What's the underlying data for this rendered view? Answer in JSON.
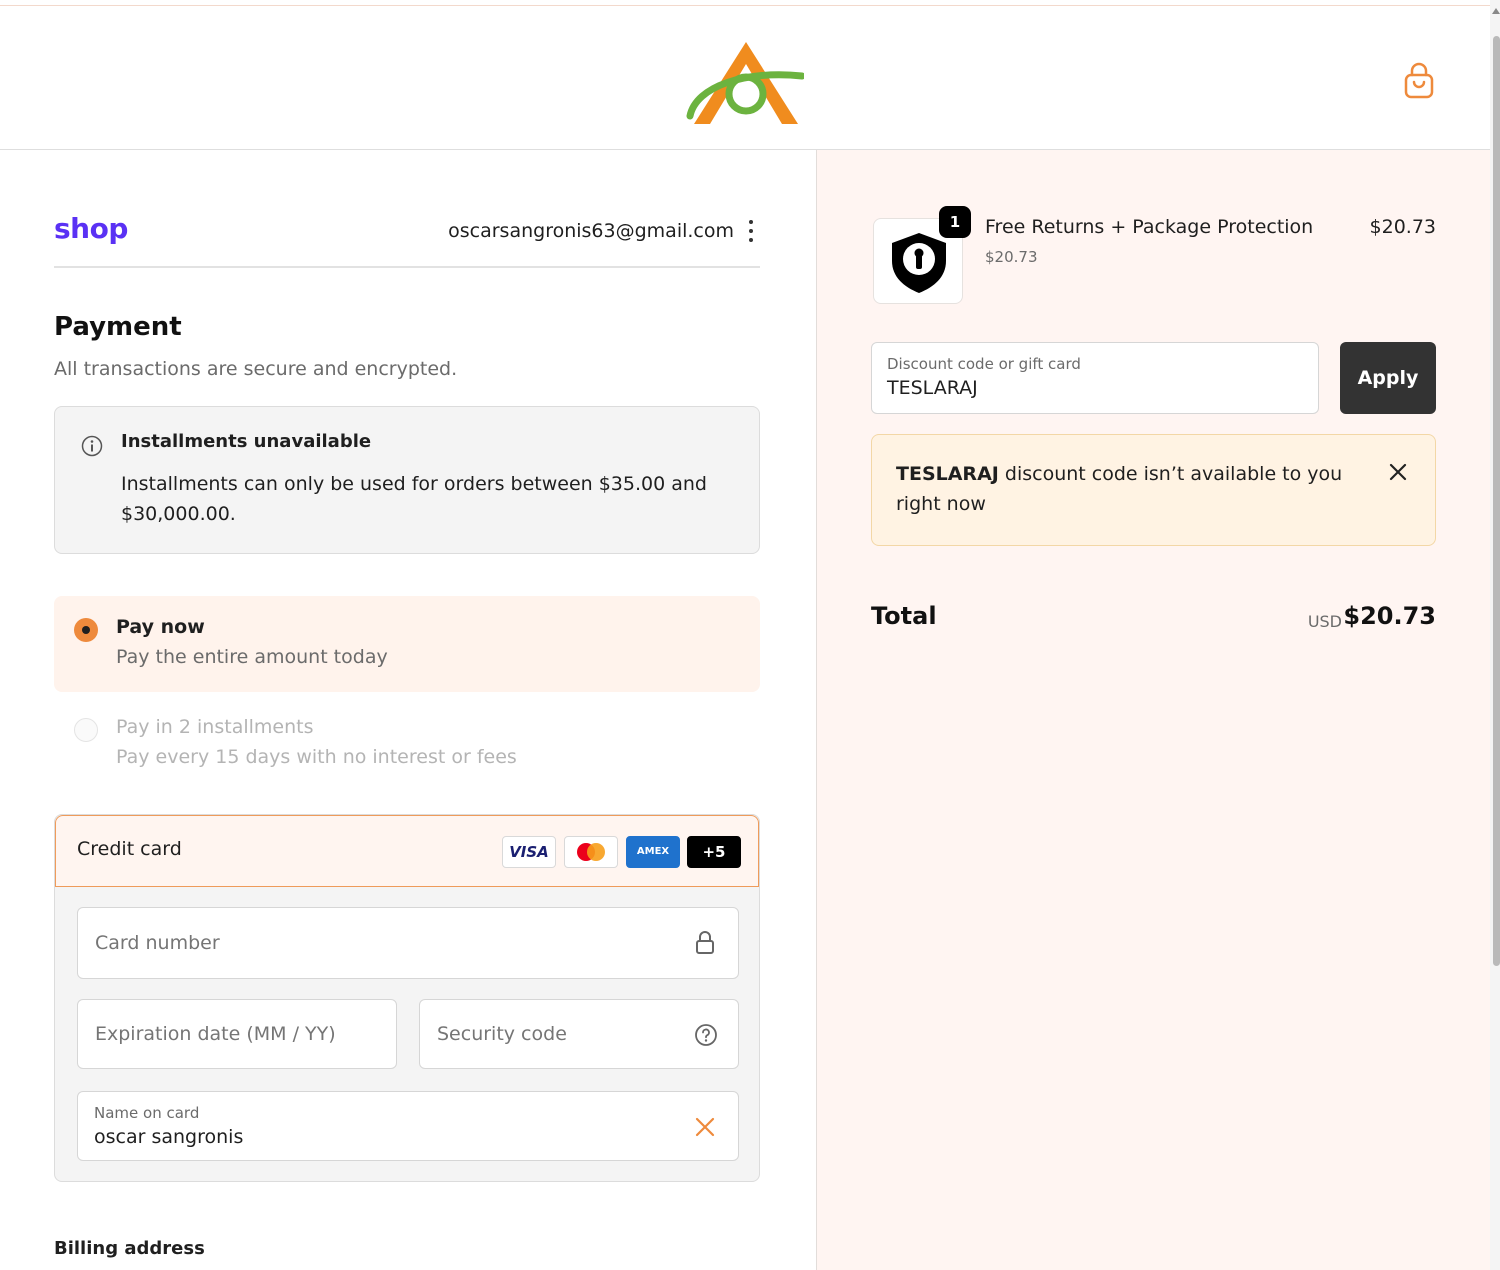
{
  "header": {
    "brand_colors": {
      "logo_orange": "#f08c1e",
      "logo_green": "#6cb33f",
      "accent": "#ee8a3c"
    },
    "cart_icon": "shopping-bag-icon"
  },
  "shop": {
    "logo_text": "shop",
    "email": "oscarsangronis63@gmail.com"
  },
  "payment": {
    "title": "Payment",
    "subtitle": "All transactions are secure and encrypted.",
    "notice_title": "Installments unavailable",
    "notice_text": "Installments can only be used for orders between $35.00 and $30,000.00.",
    "options": [
      {
        "title": "Pay now",
        "subtitle": "Pay the entire amount today",
        "selected": true
      },
      {
        "title": "Pay in 2 installments",
        "subtitle": "Pay every 15 days with no interest or fees",
        "selected": false
      }
    ]
  },
  "credit_card": {
    "label": "Credit card",
    "logos": {
      "visa": "VISA",
      "amex": "AMEX",
      "more": "+5"
    },
    "card_number_placeholder": "Card number",
    "expiration_placeholder": "Expiration date (MM / YY)",
    "security_placeholder": "Security code",
    "name_label": "Name on card",
    "name_value": "oscar sangronis"
  },
  "billing": {
    "title": "Billing address"
  },
  "summary": {
    "product": {
      "name": "Free Returns + Package Protection",
      "unit_price": "$20.73",
      "price": "$20.73",
      "quantity": "1"
    },
    "discount": {
      "label": "Discount code or gift card",
      "value": "TESLARAJ",
      "apply_label": "Apply"
    },
    "alert": {
      "code": "TESLARAJ",
      "message": " discount code isn’t available to you right now"
    },
    "total": {
      "label": "Total",
      "currency": "USD",
      "value": "$20.73"
    }
  }
}
